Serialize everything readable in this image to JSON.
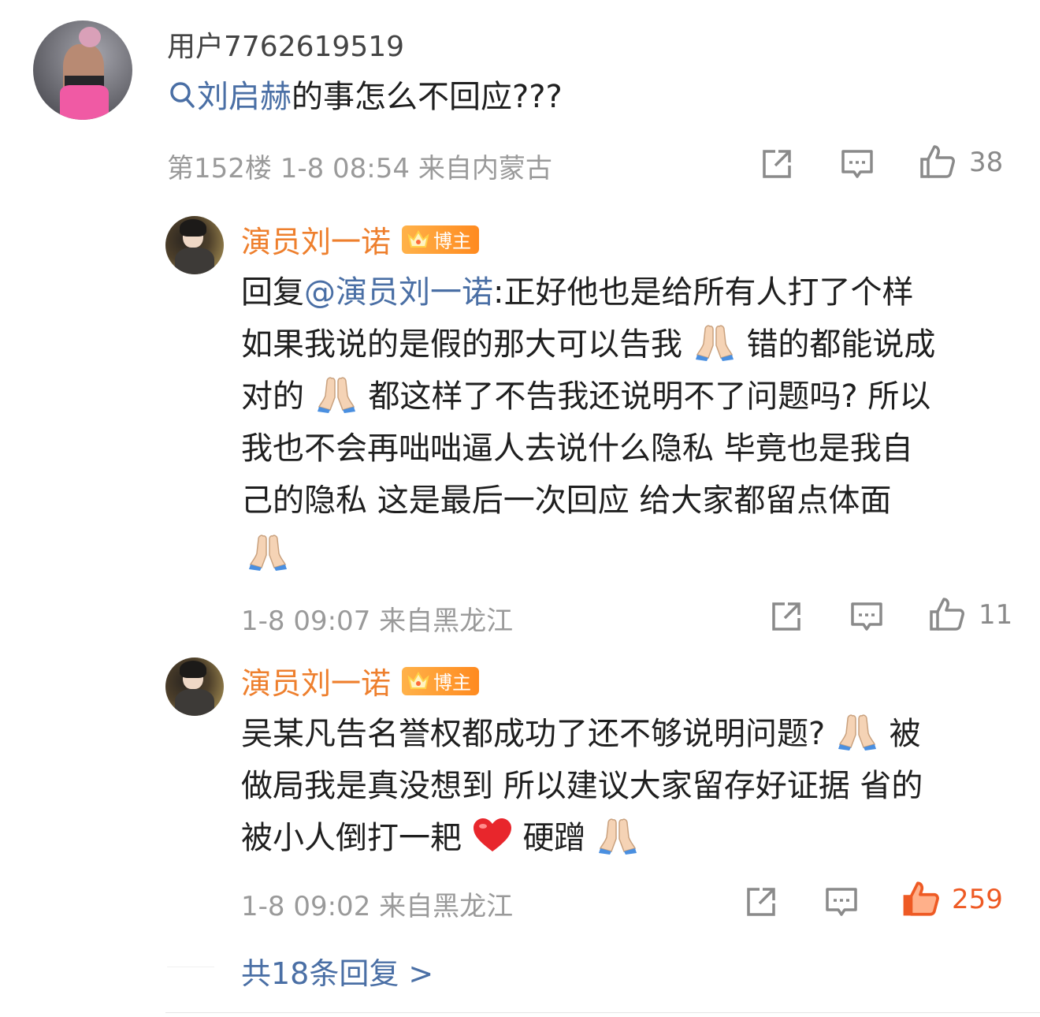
{
  "main_comment": {
    "username": "用户7762619519",
    "search_topic": "刘启赫",
    "text_after_topic": "的事怎么不回应???",
    "meta": "第152楼 1-8 08:54 来自内蒙古",
    "like_count": "38"
  },
  "reply1": {
    "name": "演员刘一诺",
    "badge": "博主",
    "prefix": "回复",
    "mention": "@演员刘一诺",
    "line1_rest": ":正好他也是给所有人打了个样",
    "line2_a": "如果我说的是假的那大可以告我",
    "line2_b": "错的都能说成",
    "line3_a": "对的",
    "line3_b": "都这样了不告我还说明不了问题吗? 所以",
    "line4": "我也不会再咄咄逼人去说什么隐私 毕竟也是我自",
    "line5": "己的隐私 这是最后一次回应 给大家都留点体面",
    "meta": "1-8 09:07 来自黑龙江",
    "like_count": "11"
  },
  "reply2": {
    "name": "演员刘一诺",
    "badge": "博主",
    "line1_a": "吴某凡告名誉权都成功了还不够说明问题?",
    "line1_b": "被",
    "line2": "做局我是真没想到 所以建议大家留存好证据 省的",
    "line3_a": "被小人倒打一耙",
    "line3_b": "硬蹭",
    "meta": "1-8 09:02 来自黑龙江",
    "like_count": "259"
  },
  "more_replies": "共18条回复 >",
  "colors": {
    "link": "#4a6fa5",
    "name_orange": "#ee7f2d",
    "meta_gray": "#9a9a9a",
    "liked": "#ee5a24"
  },
  "icons": [
    "search-icon",
    "share-icon",
    "comment-icon",
    "like-icon",
    "crown-icon",
    "pray-emoji",
    "heart-emoji"
  ]
}
